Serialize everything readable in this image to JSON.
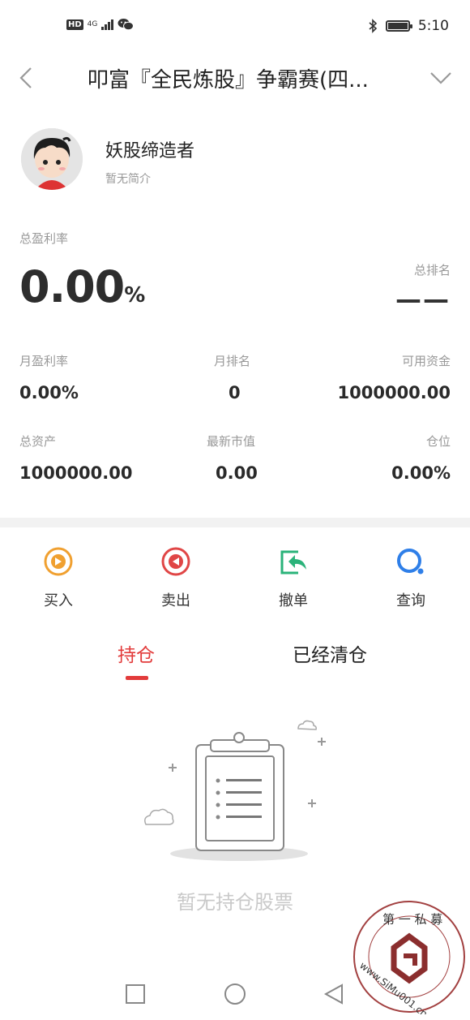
{
  "status_bar": {
    "hd": "HD",
    "network": "4G",
    "time": "5:10"
  },
  "header": {
    "title": "叩富『全民炼股』争霸赛(四..."
  },
  "profile": {
    "name": "妖股缔造者",
    "bio": "暂无简介"
  },
  "summary": {
    "total_return_label": "总盈利率",
    "total_return_value": "0.00",
    "total_return_unit": "%",
    "total_rank_label": "总排名",
    "total_rank_value": "——"
  },
  "stats": [
    {
      "label": "月盈利率",
      "value": "0.00%"
    },
    {
      "label": "月排名",
      "value": "0"
    },
    {
      "label": "可用资金",
      "value": "1000000.00"
    },
    {
      "label": "总资产",
      "value": "1000000.00"
    },
    {
      "label": "最新市值",
      "value": "0.00"
    },
    {
      "label": "仓位",
      "value": "0.00%"
    }
  ],
  "actions": [
    {
      "label": "买入",
      "icon": "buy-icon",
      "color": "#f0a030"
    },
    {
      "label": "卖出",
      "icon": "sell-icon",
      "color": "#e04646"
    },
    {
      "label": "撤单",
      "icon": "cancel-order-icon",
      "color": "#2bb37a"
    },
    {
      "label": "查询",
      "icon": "query-icon",
      "color": "#2f7fe8"
    }
  ],
  "tabs": [
    {
      "label": "持仓",
      "active": true
    },
    {
      "label": "已经清仓",
      "active": false
    }
  ],
  "empty_state": {
    "message": "暂无持仓股票"
  },
  "watermark": {
    "top_text": "第 一 私 募",
    "bottom_text": "www.SiMu001.cn"
  },
  "colors": {
    "accent": "#e23b3b",
    "muted": "#999999"
  }
}
